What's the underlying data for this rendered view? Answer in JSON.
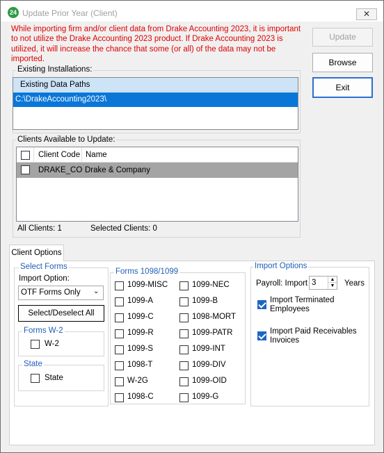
{
  "window": {
    "title": "Update Prior Year (Client)",
    "app_icon_text": "24",
    "close_glyph": "✕"
  },
  "warning_text": "While importing firm and/or client data from Drake Accounting 2023, it is important to not utilize the Drake Accounting 2023 product. If Drake Accounting 2023 is utilized, it will increase the chance that some (or all) of the data may not be imported.",
  "buttons": {
    "update": "Update",
    "browse": "Browse",
    "exit": "Exit"
  },
  "installations": {
    "group_label": "Existing Installations:",
    "column_header": "Existing Data Paths",
    "rows": [
      "C:\\DrakeAccounting2023\\"
    ]
  },
  "clients": {
    "group_label": "Clients Available to Update:",
    "headers": {
      "code": "Client Code",
      "name": "Name"
    },
    "rows": [
      {
        "code": "DRAKE_CO",
        "name": "Drake & Company"
      }
    ],
    "all_clients": "All Clients: 1",
    "selected_clients": "Selected Clients: 0"
  },
  "tabs": [
    "Client Options"
  ],
  "client_options": {
    "select_forms": {
      "label": "Select Forms",
      "import_option_label": "Import Option:",
      "import_option_value": "OTF Forms Only",
      "select_all_button": "Select/Deselect All"
    },
    "forms_w2": {
      "label": "Forms W-2",
      "items": [
        "W-2"
      ]
    },
    "state": {
      "label": "State",
      "items": [
        "State"
      ]
    },
    "forms_1098_1099": {
      "label": "Forms 1098/1099",
      "col1": [
        "1099-MISC",
        "1099-A",
        "1099-C",
        "1099-R",
        "1099-S",
        "1098-T",
        "W-2G",
        "1098-C"
      ],
      "col2": [
        "1099-NEC",
        "1099-B",
        "1098-MORT",
        "1099-PATR",
        "1099-INT",
        "1099-DIV",
        "1099-OID",
        "1099-G"
      ]
    },
    "import_options": {
      "label": "Import Options",
      "payroll_label": "Payroll: Import",
      "payroll_years_value": "3",
      "years_label": "Years",
      "import_terminated": "Import Terminated Employees",
      "import_terminated_checked": true,
      "import_paid_receivables": "Import Paid Receivables Invoices",
      "import_paid_receivables_checked": true
    }
  },
  "colors": {
    "warning": "#e00000",
    "selection": "#0a77d8",
    "accent_blue": "#1f5fb8"
  }
}
